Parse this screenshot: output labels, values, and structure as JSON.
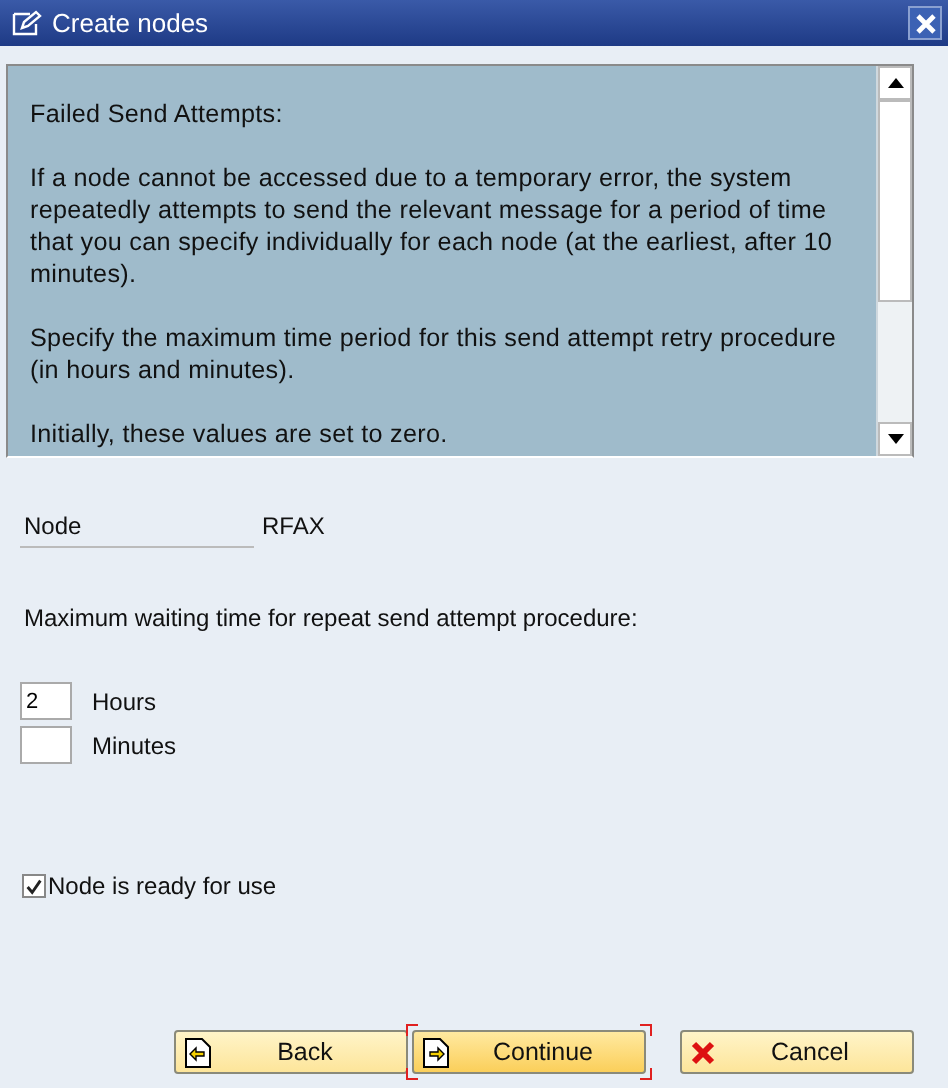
{
  "window": {
    "title": "Create nodes"
  },
  "help": {
    "heading": "Failed Send Attempts:",
    "paragraphs": [
      "If a node cannot be accessed due to a temporary error, the system repeatedly attempts to send the relevant message for a period of time that you can specify individually for each node (at the earliest, after 10 minutes).",
      "Specify the maximum time period for this send attempt retry procedure (in hours and minutes).",
      "Initially, these values are set to zero."
    ]
  },
  "node": {
    "label": "Node",
    "value": "RFAX"
  },
  "waiting_label": "Maximum waiting time for repeat send attempt procedure:",
  "fields": [
    {
      "label": "Hours",
      "value": "2"
    },
    {
      "label": "Minutes"
    }
  ],
  "ready": {
    "label": "Node is ready for use",
    "checked": true
  },
  "buttons": [
    {
      "kind": "back",
      "label": "Back",
      "focused": false
    },
    {
      "kind": "continue",
      "label": "Continue",
      "focused": true
    },
    {
      "kind": "cancel",
      "label": "Cancel",
      "focused": false
    }
  ]
}
